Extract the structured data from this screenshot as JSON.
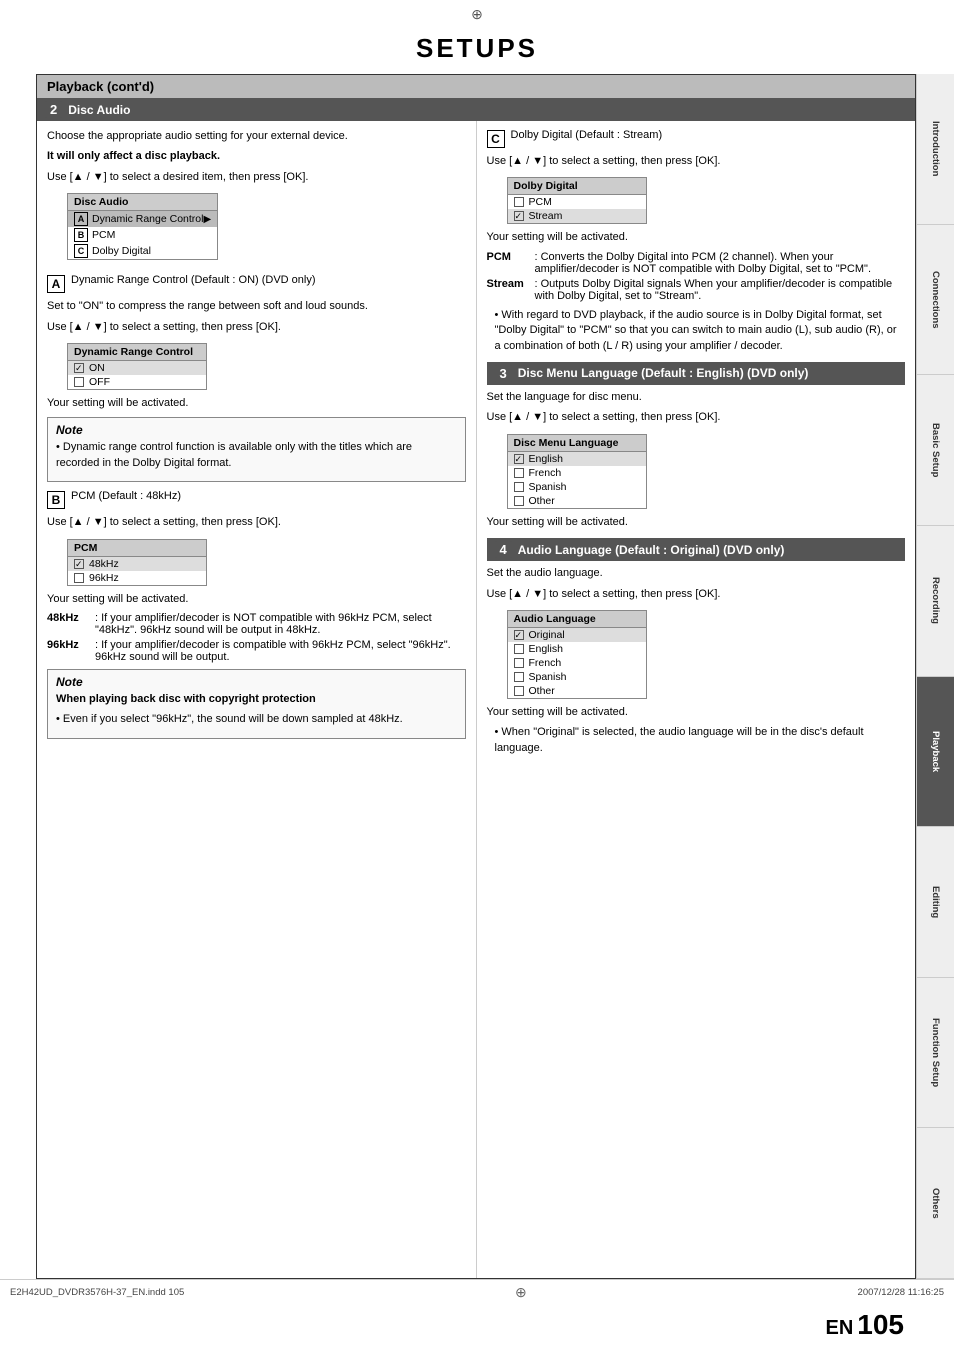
{
  "page": {
    "title": "SETUPS",
    "crosshair": "⊕",
    "page_number": "105",
    "en_label": "EN",
    "bottom_left": "E2H42UD_DVDR3576H-37_EN.indd  105",
    "bottom_right": "2007/12/28  11:16:25"
  },
  "playback_section": {
    "header": "Playback (cont'd)"
  },
  "section2": {
    "number": "2",
    "title": "Disc Audio",
    "intro": "Choose the appropriate audio setting for your external device.",
    "note1": "It will only affect a disc playback.",
    "instruction": "Use [▲ / ▼] to select a desired item, then press [OK].",
    "disc_audio_menu": {
      "title": "Disc Audio",
      "items": [
        {
          "label": "A",
          "text": "Dynamic Range Control",
          "selected": true
        },
        {
          "label": "B",
          "text": "PCM",
          "selected": false
        },
        {
          "label": "C",
          "text": "Dolby Digital",
          "selected": false
        }
      ]
    },
    "subA": {
      "badge": "A",
      "label": "Dynamic Range Control (Default : ON)   (DVD only)",
      "desc": "Set to \"ON\" to compress the range between soft and loud sounds.",
      "instruction": "Use [▲ / ▼] to select a setting, then press [OK].",
      "menu": {
        "title": "Dynamic Range Control",
        "items": [
          {
            "text": "ON",
            "checked": true
          },
          {
            "text": "OFF",
            "checked": false
          }
        ]
      },
      "activated": "Your setting will be activated.",
      "note": {
        "title": "Note",
        "text": "• Dynamic range control function is available only with the titles which are recorded in the Dolby Digital format."
      }
    },
    "subB": {
      "badge": "B",
      "label": "PCM (Default : 48kHz)",
      "instruction": "Use [▲ / ▼] to select a setting, then press [OK].",
      "menu": {
        "title": "PCM",
        "items": [
          {
            "text": "48kHz",
            "checked": true
          },
          {
            "text": "96kHz",
            "checked": false
          }
        ]
      },
      "activated": "Your setting will be activated.",
      "descs": [
        {
          "label": "48kHz",
          "text": ": If your amplifier/decoder is NOT compatible with 96kHz PCM, select \"48kHz\". 96kHz sound will be output in 48kHz."
        },
        {
          "label": "96kHz",
          "text": ": If your amplifier/decoder is compatible with 96kHz PCM, select \"96kHz\". 96kHz sound will be output."
        }
      ],
      "note": {
        "title": "Note",
        "bold_line": "When playing back disc with copyright protection",
        "text": "• Even if you select \"96kHz\", the sound will be down sampled at 48kHz."
      }
    }
  },
  "sectionC": {
    "badge": "C",
    "label": "Dolby Digital (Default : Stream)",
    "instruction": "Use [▲ / ▼] to select a setting, then press [OK].",
    "menu": {
      "title": "Dolby Digital",
      "items": [
        {
          "text": "PCM",
          "checked": false
        },
        {
          "text": "Stream",
          "checked": true
        }
      ]
    },
    "activated": "Your setting will be activated.",
    "descs": [
      {
        "label": "PCM",
        "text": ": Converts the Dolby Digital into PCM (2 channel). When your amplifier/decoder is NOT compatible with Dolby Digital, set to \"PCM\"."
      },
      {
        "label": "Stream",
        "text": ": Outputs Dolby Digital signals When your amplifier/decoder is compatible with Dolby Digital, set to \"Stream\"."
      }
    ],
    "bullet": "• With regard to DVD playback, if the audio source is in Dolby Digital format, set \"Dolby Digital\" to \"PCM\" so that you can switch to main audio (L), sub audio (R), or a combination of both (L / R) using your amplifier / decoder."
  },
  "section3": {
    "number": "3",
    "title": "Disc Menu Language (Default : English) (DVD only)",
    "intro": "Set the language for disc menu.",
    "instruction": "Use [▲ / ▼] to select a setting, then press [OK].",
    "menu": {
      "title": "Disc Menu Language",
      "items": [
        {
          "text": "English",
          "checked": true
        },
        {
          "text": "French",
          "checked": false
        },
        {
          "text": "Spanish",
          "checked": false
        },
        {
          "text": "Other",
          "checked": false
        }
      ]
    },
    "activated": "Your setting will be activated."
  },
  "section4": {
    "number": "4",
    "title": "Audio Language (Default : Original)  (DVD only)",
    "intro": "Set the audio language.",
    "instruction": "Use [▲ / ▼] to select a setting, then press [OK].",
    "menu": {
      "title": "Audio Language",
      "items": [
        {
          "text": "Original",
          "checked": true
        },
        {
          "text": "English",
          "checked": false
        },
        {
          "text": "French",
          "checked": false
        },
        {
          "text": "Spanish",
          "checked": false
        },
        {
          "text": "Other",
          "checked": false
        }
      ]
    },
    "activated": "Your setting will be activated.",
    "bullet": "• When \"Original\" is selected, the audio language will be in the disc's default language."
  },
  "sidebar": {
    "tabs": [
      {
        "label": "Introduction",
        "active": false
      },
      {
        "label": "Connections",
        "active": false
      },
      {
        "label": "Basic Setup",
        "active": false
      },
      {
        "label": "Recording",
        "active": false
      },
      {
        "label": "Playback",
        "active": true
      },
      {
        "label": "Editing",
        "active": false
      },
      {
        "label": "Function Setup",
        "active": false
      },
      {
        "label": "Others",
        "active": false
      }
    ]
  }
}
